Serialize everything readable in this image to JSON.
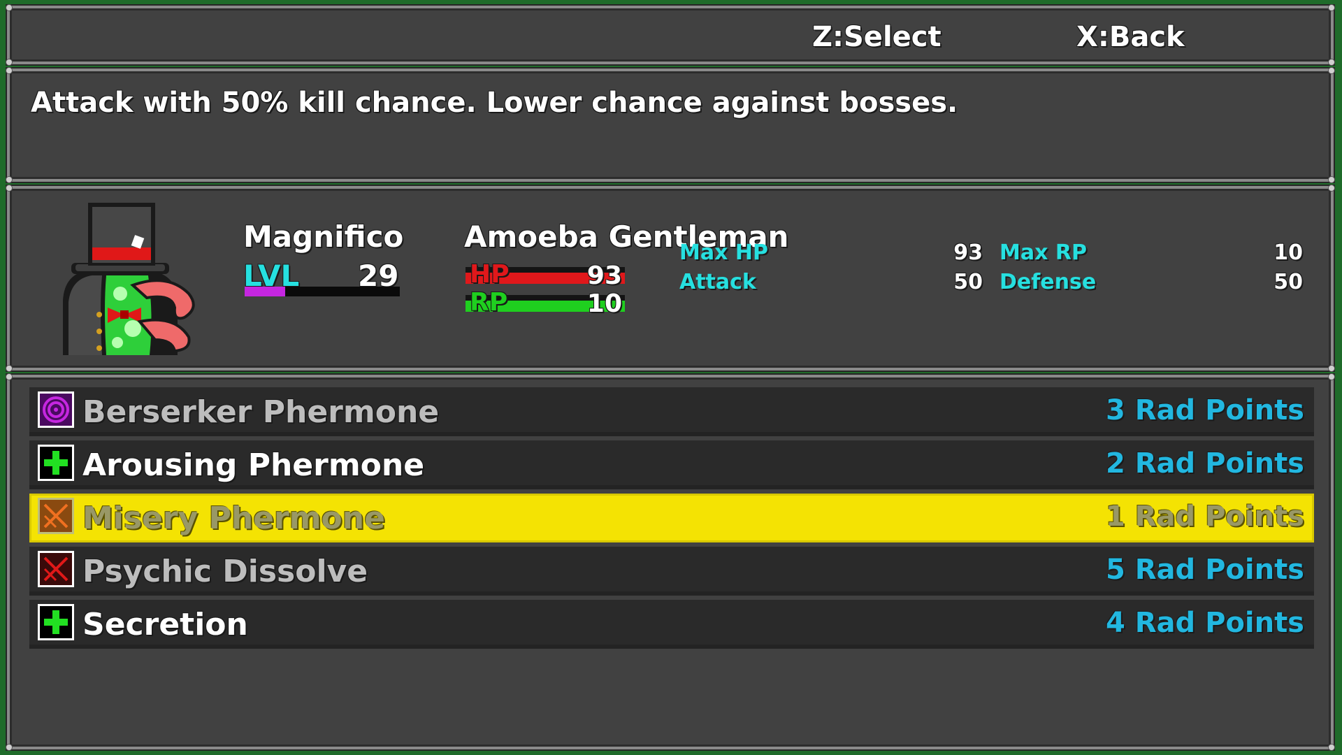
{
  "controls": {
    "select_hint": "Z:Select",
    "back_hint": "X:Back"
  },
  "description": "Attack with 50% kill chance. Lower chance against bosses.",
  "character": {
    "name": "Magnifico",
    "class": "Amoeba Gentleman",
    "lvl_label": "LVL",
    "level": "29",
    "level_progress": 0.26,
    "hp_label": "HP",
    "hp": "93",
    "hp_fraction": 1.0,
    "rp_label": "RP",
    "rp": "10",
    "rp_fraction": 1.0,
    "portrait_icon": "amoeba-gentleman-portrait",
    "stats": [
      {
        "label": "Max HP",
        "value": "93"
      },
      {
        "label": "Max RP",
        "value": "10"
      },
      {
        "label": "Attack",
        "value": "50"
      },
      {
        "label": "Defense",
        "value": "50"
      }
    ]
  },
  "skills": [
    {
      "name": "Berserker Phermone",
      "cost": "3 Rad Points",
      "icon": "spiral-icon",
      "available": false,
      "selected": false
    },
    {
      "name": "Arousing Phermone",
      "cost": "2 Rad Points",
      "icon": "green-cross-icon",
      "available": true,
      "selected": false
    },
    {
      "name": "Misery Phermone",
      "cost": "1 Rad Points",
      "icon": "orange-slash-icon",
      "available": false,
      "selected": true
    },
    {
      "name": "Psychic Dissolve",
      "cost": "5 Rad Points",
      "icon": "red-slash-icon",
      "available": false,
      "selected": false
    },
    {
      "name": "Secretion",
      "cost": "4 Rad Points",
      "icon": "green-cross-icon",
      "available": true,
      "selected": false
    }
  ],
  "colors": {
    "panel": "#414141",
    "highlight": "#f4e303",
    "stat_label": "#26e0e0",
    "cost": "#22b7e0",
    "hp": "#e0181b",
    "rp": "#1fcf1f",
    "level_bar": "#c526e0"
  }
}
